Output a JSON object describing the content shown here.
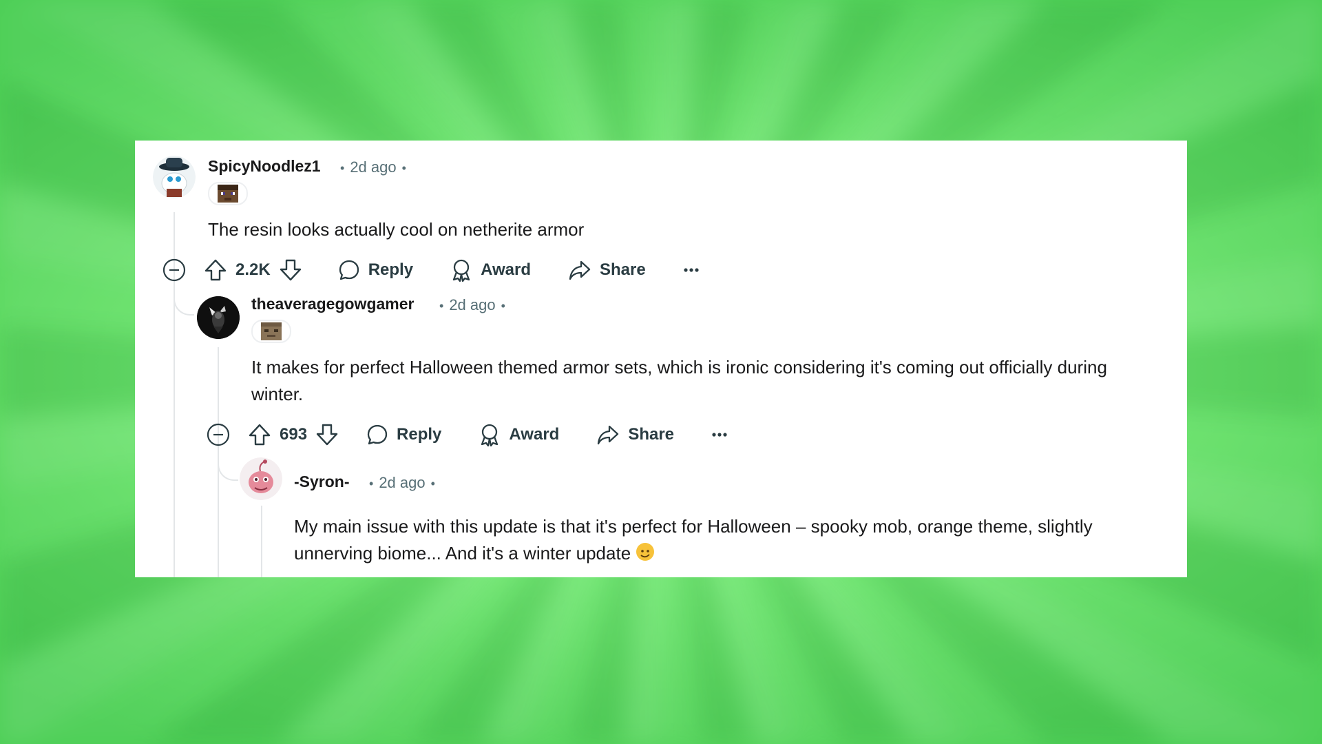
{
  "comments": [
    {
      "username": "SpicyNoodlez1",
      "time": "2d ago",
      "text": "The resin looks actually cool on netherite armor",
      "score": "2.2K",
      "reply_label": "Reply",
      "award_label": "Award",
      "share_label": "Share"
    },
    {
      "username": "theaveragegowgamer",
      "time": "2d ago",
      "text": "It makes for perfect Halloween themed armor sets, which is ironic considering it's coming out officially during winter.",
      "score": "693",
      "reply_label": "Reply",
      "award_label": "Award",
      "share_label": "Share"
    },
    {
      "username": "-Syron-",
      "time": "2d ago",
      "text": "My main issue with this update is that it's perfect for Halloween – spooky mob, orange theme, slightly unnerving biome... And it's a winter update"
    }
  ],
  "icons": {
    "collapse": "minus-circle-icon",
    "upvote": "arrow-up-icon",
    "downvote": "arrow-down-icon",
    "reply": "speech-bubble-icon",
    "award": "award-ribbon-icon",
    "share": "share-arrow-icon",
    "more": "ellipsis-icon"
  },
  "colors": {
    "background": "#6fe86f",
    "card": "#ffffff",
    "text": "#1a1a1b",
    "meta": "#576f76",
    "thread_line": "#e3e6e8"
  }
}
